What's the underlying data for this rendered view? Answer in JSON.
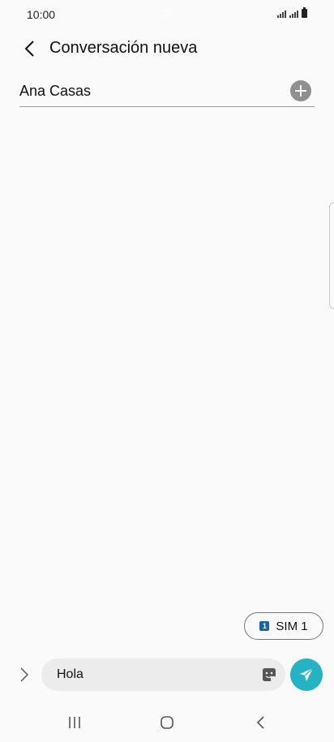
{
  "status_bar": {
    "time": "10:00"
  },
  "header": {
    "title": "Conversación nueva"
  },
  "recipient": {
    "name": "Ana Casas"
  },
  "sim": {
    "label": "SIM 1",
    "badge": "1"
  },
  "compose": {
    "message": "Hola"
  },
  "icons": {
    "back": "arrow-back-icon",
    "add": "plus-circle-icon",
    "expand": "chevron-right-icon",
    "sticker": "sticker-icon",
    "send": "send-icon",
    "nav_recent": "recent-apps-icon",
    "nav_home": "home-icon",
    "nav_back": "nav-back-icon"
  },
  "colors": {
    "send_button": "#24b3c2",
    "sim_badge": "#1268a6",
    "background": "#fafafa"
  }
}
